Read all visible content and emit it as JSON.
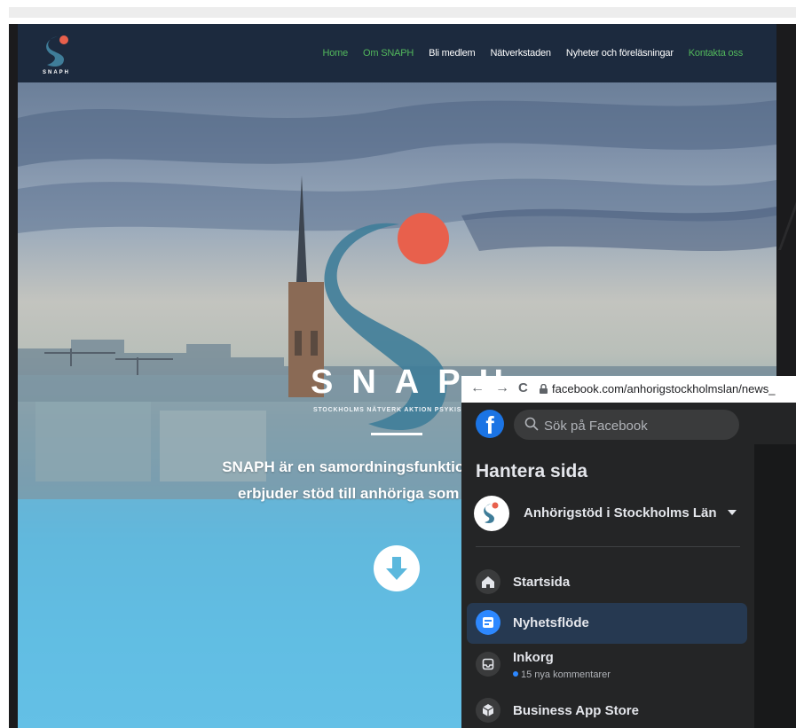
{
  "website": {
    "logo_text": "SNAPH",
    "nav": [
      {
        "label": "Home",
        "active": true
      },
      {
        "label": "Om SNAPH",
        "active": true
      },
      {
        "label": "Bli medlem",
        "active": false
      },
      {
        "label": "Nätverkstaden",
        "active": false
      },
      {
        "label": "Nyheter och föreläsningar",
        "active": false
      },
      {
        "label": "Kontakta oss",
        "active": true
      }
    ],
    "hero": {
      "title": "SNAPH",
      "tagline": "STOCKHOLMS NÄTVERK AKTION PSYKISK",
      "line1": "SNAPH är en samordningsfunktion för aktörer i",
      "line2": "erbjuder stöd till anhöriga som lever nära pe",
      "down_icon": "arrow-down-icon"
    },
    "colors": {
      "nav_bg": "#1c2a3e",
      "active_link": "#52b85c",
      "logo_teal": "#3f7d99",
      "logo_orange": "#e8604c"
    }
  },
  "browser": {
    "url": "facebook.com/anhorigstockholmslan/news_",
    "back_icon": "←",
    "forward_icon": "→",
    "reload_icon": "C"
  },
  "facebook": {
    "logo": "f",
    "search_placeholder": "Sök på Facebook",
    "heading": "Hantera sida",
    "page_name": "Anhörigstöd i Stockholms Län",
    "menu": [
      {
        "label": "Startsida",
        "icon": "home-icon",
        "selected": false
      },
      {
        "label": "Nyhetsflöde",
        "icon": "news-feed-icon",
        "selected": true
      },
      {
        "label": "Inkorg",
        "sub": "15 nya kommentarer",
        "icon": "inbox-icon",
        "selected": false
      },
      {
        "label": "Business App Store",
        "icon": "app-store-icon",
        "selected": false
      }
    ],
    "colors": {
      "brand": "#1b74e4",
      "panel": "#242526",
      "selected_bg": "#263951"
    }
  }
}
